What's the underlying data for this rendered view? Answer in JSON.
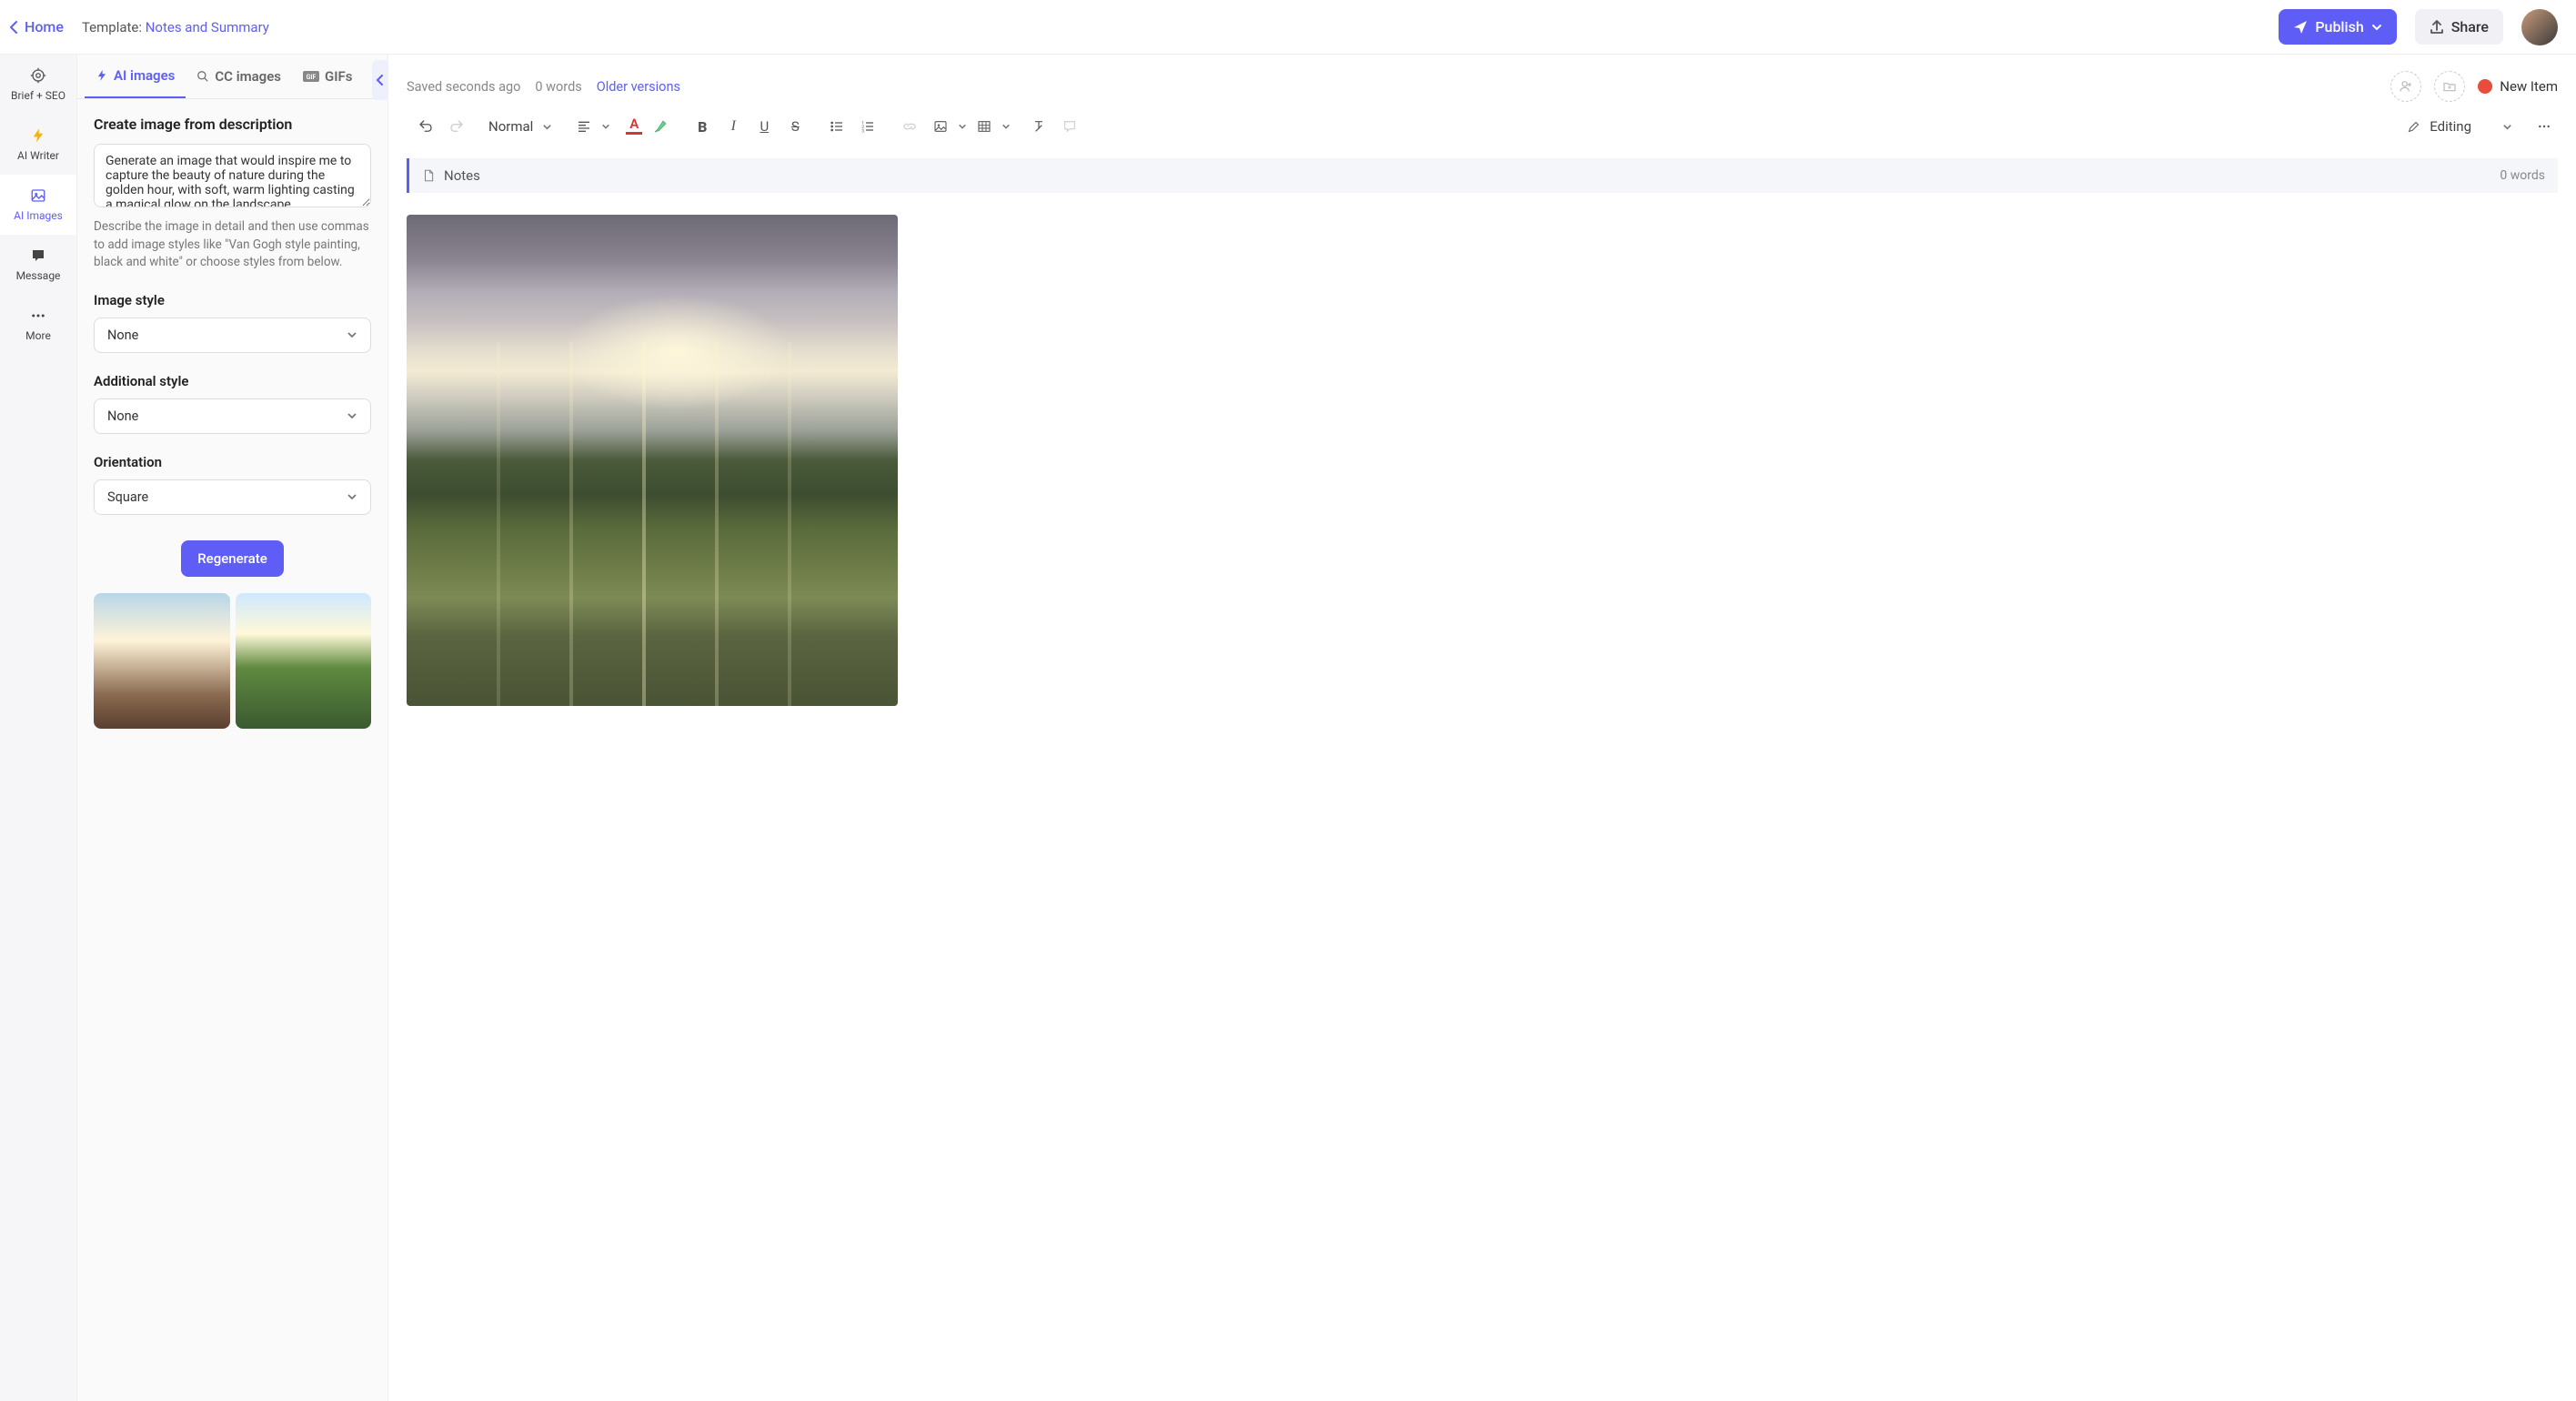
{
  "top": {
    "home": "Home",
    "template_label": "Template: ",
    "template_value": "Notes and Summary",
    "publish": "Publish",
    "share": "Share"
  },
  "rail": {
    "brief": "Brief + SEO",
    "writer": "AI Writer",
    "images": "AI Images",
    "message": "Message",
    "more": "More"
  },
  "tabs": {
    "ai_images": "AI images",
    "cc_images": "CC images",
    "gifs": "GIFs"
  },
  "panel": {
    "create_heading": "Create image from description",
    "description_value": "Generate an image that would inspire me to capture the beauty of nature during the golden hour, with soft, warm lighting casting a magical glow on the landscape",
    "help_text": "Describe the image in detail and then use commas to add image styles like \"Van Gogh style painting, black and white\" or choose styles from below.",
    "image_style_label": "Image style",
    "image_style_value": "None",
    "additional_style_label": "Additional style",
    "additional_style_value": "None",
    "orientation_label": "Orientation",
    "orientation_value": "Square",
    "regenerate": "Regenerate"
  },
  "editor": {
    "saved": "Saved seconds ago",
    "words_top": "0 words",
    "older_versions": "Older versions",
    "new_item": "New Item",
    "format_select": "Normal",
    "editing_mode": "Editing",
    "notes_label": "Notes",
    "notes_words": "0 words"
  }
}
